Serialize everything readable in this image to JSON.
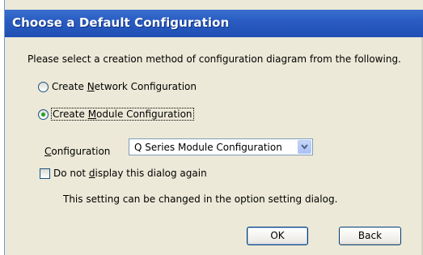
{
  "window": {
    "title": "Choose a Default Configuration"
  },
  "dialog": {
    "prompt": "Please select a creation method of configuration diagram from the following.",
    "options": [
      {
        "label_pre": "Create ",
        "label_key": "N",
        "label_post": "etwork Configuration",
        "selected": false
      },
      {
        "label_pre": "Create ",
        "label_key": "M",
        "label_post": "odule Configuration",
        "selected": true
      }
    ],
    "configuration": {
      "label_key": "C",
      "label_post": "onfiguration",
      "selected_value": "Q Series Module Configuration"
    },
    "dont_show": {
      "label_pre": "Do not ",
      "label_key": "d",
      "label_post": "isplay this dialog again",
      "checked": false
    },
    "info": "This setting can be changed in the option setting dialog.",
    "buttons": {
      "ok": "OK",
      "back": "Back"
    }
  }
}
